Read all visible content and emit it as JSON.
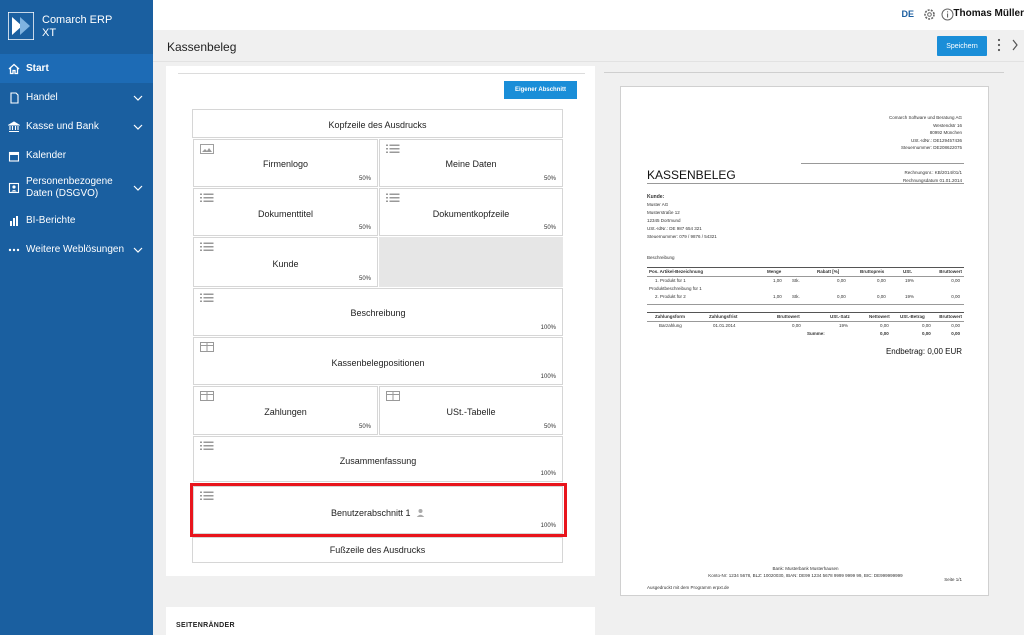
{
  "app": {
    "name_line1": "Comarch ERP",
    "name_line2": "XT"
  },
  "sidebar": {
    "items": [
      {
        "label": "Start",
        "icon": "home-icon"
      },
      {
        "label": "Handel",
        "icon": "document-icon"
      },
      {
        "label": "Kasse und Bank",
        "icon": "bank-icon"
      },
      {
        "label": "Kalender",
        "icon": "calendar-icon"
      },
      {
        "label_line1": "Personenbezogene",
        "label_line2": "Daten (DSGVO)",
        "icon": "person-icon"
      },
      {
        "label": "BI-Berichte",
        "icon": "bar-chart-icon"
      },
      {
        "label": "Weitere Weblösungen",
        "icon": "dots-icon"
      }
    ]
  },
  "topbar": {
    "language": "DE",
    "user": "Thomas Müller"
  },
  "header": {
    "title": "Kassenbeleg",
    "save_label": "Speichern"
  },
  "editor": {
    "add_section_label": "Eigener Abschnitt",
    "header_row": "Kopfzeile des Ausdrucks",
    "footer_row": "Fußzeile des Ausdrucks",
    "blocks": [
      {
        "title": "Firmenlogo",
        "pct": "50%"
      },
      {
        "title": "Meine Daten",
        "pct": "50%"
      },
      {
        "title": "Dokumenttitel",
        "pct": "50%"
      },
      {
        "title": "Dokumentkopfzeile",
        "pct": "50%"
      },
      {
        "title": "Kunde",
        "pct": "50%"
      },
      {
        "title": "Beschreibung",
        "pct": "100%"
      },
      {
        "title": "Kassenbelegpositionen",
        "pct": "100%"
      },
      {
        "title": "Zahlungen",
        "pct": "50%"
      },
      {
        "title": "USt.-Tabelle",
        "pct": "50%"
      },
      {
        "title": "Zusammenfassung",
        "pct": "100%"
      },
      {
        "title": "Benutzerabschnitt 1",
        "pct": "100%"
      }
    ],
    "bottom_label": "SEITENRÄNDER"
  },
  "preview": {
    "company": [
      "Comarch Software und Beratung AG",
      "Westendstr 16",
      "80992 München",
      "USt.-IdNr.: DE129457436",
      "Steuernummer: DE208622075"
    ],
    "title": "KASSENBELEG",
    "bill_no": "Rechnungsnr.: KB/2014/01/1",
    "bill_date": "Rechnungsdatum 01.01.2014",
    "customer_heading": "Kunde:",
    "customer": [
      "Muster AG",
      "Musterstraße 12",
      "12345 Dortmund",
      "USt.-IdNr.: DE 987 654 321",
      "Steuernummer: 079 / 9876 / 54321"
    ],
    "description": "Beschreibung",
    "items_header": [
      "Pos. Artikel-Bezeichnung",
      "Menge",
      "Rabatt [%]",
      "Bruttopreis",
      "USt.",
      "Bruttowert"
    ],
    "items": [
      {
        "pos": "1. Produkt für 1",
        "qty": "1,00",
        "unit": "Stk.",
        "disc": "0,00",
        "price": "0,00",
        "vat": "19%",
        "total": "0,00"
      },
      {
        "note": "Produktbeschreibung für 1"
      },
      {
        "pos": "2. Produkt für 2",
        "qty": "1,00",
        "unit": "Stk.",
        "disc": "0,00",
        "price": "0,00",
        "vat": "19%",
        "total": "0,00"
      }
    ],
    "pay_header": [
      "Zahlungsform",
      "Zahlungsfrist",
      "Bruttowert",
      "USt.-Satz",
      "Nettowert",
      "USt.-Betrag",
      "Bruttowert"
    ],
    "pay_row": [
      "Barzahlung",
      "01.01.2014",
      "0,00",
      "19%",
      "0,00",
      "0,00",
      "0,00"
    ],
    "pay_sum_label": "Summe:",
    "pay_sum": [
      "0,00",
      "0,00",
      "0,00"
    ],
    "end_total": "Endbetrag: 0,00 EUR",
    "footer_line1": "Bank: Musterbank Musterhausen",
    "footer_line2": "Konto-Nr: 1234 5678, BLZ: 10020030, IBAN: DE99 1234 5678 9999 9999 99, BIC: DE999999999",
    "page_label": "Seite 1/1",
    "printed_with": "Ausgedruckt mit dem Programm erpxt.de"
  }
}
